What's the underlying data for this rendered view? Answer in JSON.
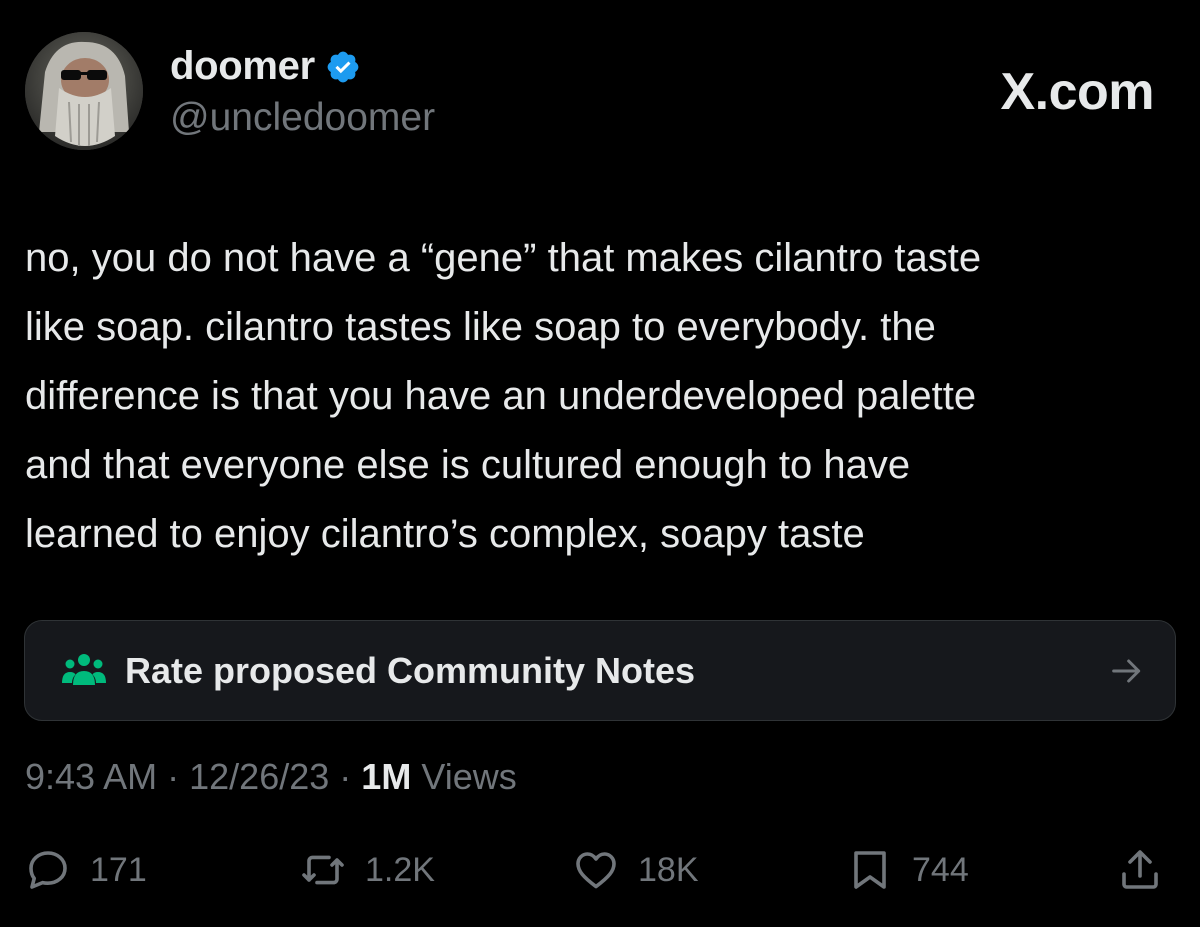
{
  "author": {
    "display_name": "doomer",
    "handle": "@uncledoomer",
    "verified_icon": "verified-badge-icon",
    "avatar_icon": "avatar-photo"
  },
  "brand": {
    "label": "X.com"
  },
  "tweet": {
    "lines": [
      "no, you do not have a “gene” that makes cilantro taste",
      "like soap. cilantro tastes like soap to everybody. the",
      "difference is that you have an underdeveloped palette",
      "and that everyone else is cultured enough to have",
      "learned to enjoy cilantro’s complex, soapy taste"
    ]
  },
  "community_notes": {
    "label": "Rate proposed Community Notes",
    "icon": "people-group-icon",
    "arrow_icon": "arrow-right-icon"
  },
  "meta": {
    "time": "9:43 AM",
    "separator": "·",
    "date": "12/26/23",
    "views_count": "1M",
    "views_label": "Views"
  },
  "actions": {
    "replies": "171",
    "reposts": "1.2K",
    "likes": "18K",
    "bookmarks": "744"
  },
  "colors": {
    "background": "#000000",
    "primary_text": "#e7e9ea",
    "secondary_text": "#71767b",
    "verified_blue": "#1d9bf0",
    "notes_green": "#00ba7c",
    "card_bg": "#16181c"
  }
}
